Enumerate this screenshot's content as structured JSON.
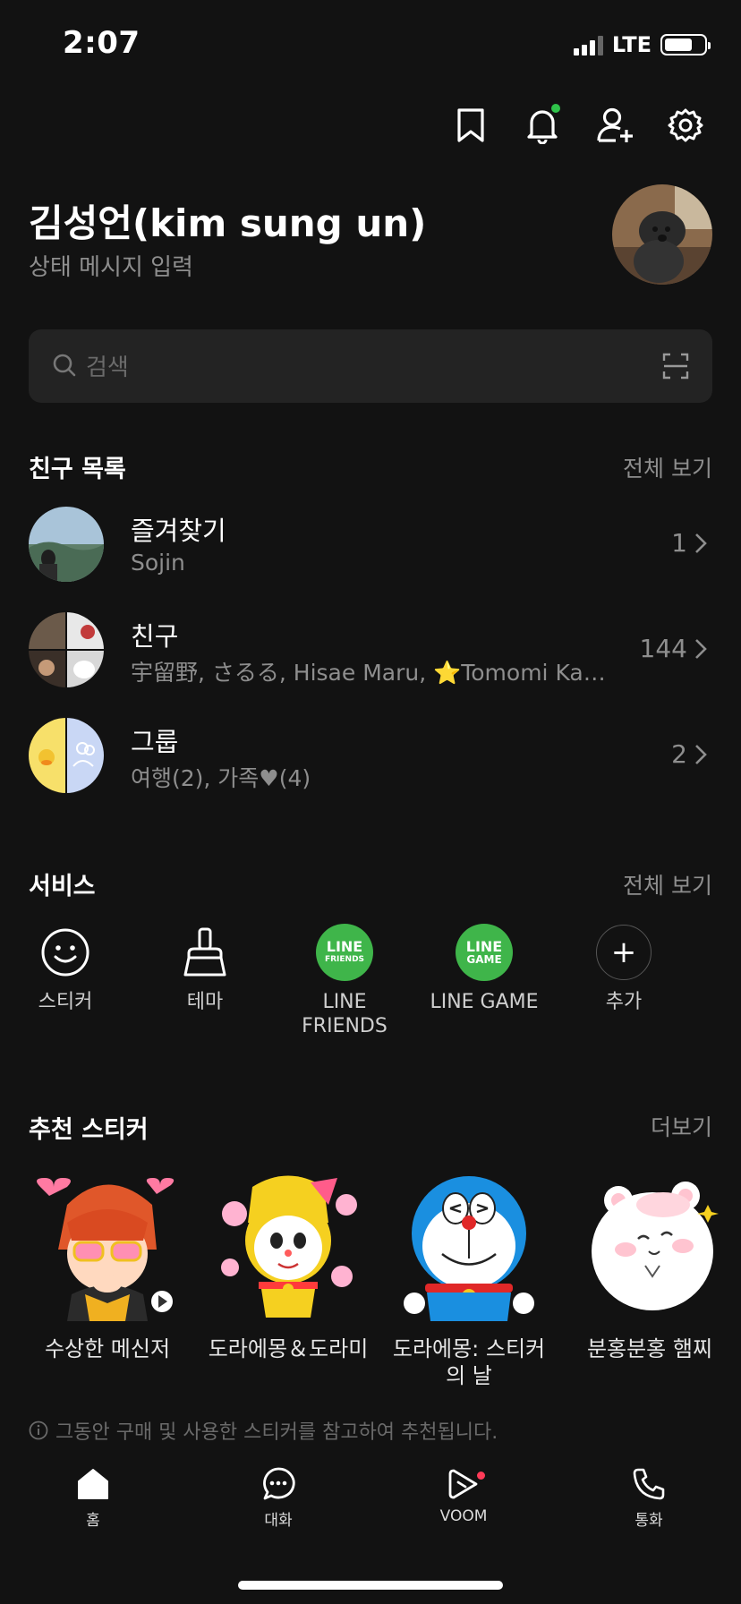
{
  "status_bar": {
    "time": "2:07",
    "network": "LTE"
  },
  "profile": {
    "name": "김성언(kim sung un)",
    "status_message": "상태 메시지 입력"
  },
  "search": {
    "placeholder": "검색"
  },
  "friends_section": {
    "title": "친구 목록",
    "view_all": "전체 보기",
    "rows": [
      {
        "title": "즐겨찾기",
        "subtitle": "Sojin",
        "count": "1"
      },
      {
        "title": "친구",
        "subtitle": "宇留野, さるる, Hisae Maru, ⭐Tomomi Kawaguchi",
        "count": "144"
      },
      {
        "title": "그룹",
        "subtitle": "여행(2), 가족♥(4)",
        "count": "2"
      }
    ]
  },
  "services_section": {
    "title": "서비스",
    "view_all": "전체 보기",
    "items": [
      {
        "label": "스티커",
        "icon": "smile-icon"
      },
      {
        "label": "테마",
        "icon": "brush-icon"
      },
      {
        "label": "LINE\nFRIENDS",
        "icon": "line-friends-icon",
        "logo_top": "LINE",
        "logo_bottom": "FRIENDS"
      },
      {
        "label": "LINE GAME",
        "icon": "line-game-icon",
        "logo_top": "LINE",
        "logo_bottom": "GAME"
      },
      {
        "label": "추가",
        "icon": "plus-icon"
      }
    ]
  },
  "stickers_section": {
    "title": "추천 스티커",
    "more": "더보기",
    "items": [
      {
        "name": "수상한 메신저"
      },
      {
        "name": "도라에몽＆도라미"
      },
      {
        "name": "도라에몽: 스티커의 날"
      },
      {
        "name": "분홍분홍 햄찌"
      }
    ],
    "note": "그동안 구매 및 사용한 스티커를 참고하여 추천됩니다."
  },
  "bottom_nav": {
    "items": [
      {
        "label": "홈",
        "icon": "home-icon"
      },
      {
        "label": "대화",
        "icon": "chat-icon"
      },
      {
        "label": "VOOM",
        "icon": "voom-icon"
      },
      {
        "label": "통화",
        "icon": "phone-icon"
      }
    ]
  },
  "colors": {
    "background": "#121212",
    "accent_green": "#3fb54a",
    "notification_dot": "#2fc34a",
    "voom_dot": "#ff3b58"
  }
}
